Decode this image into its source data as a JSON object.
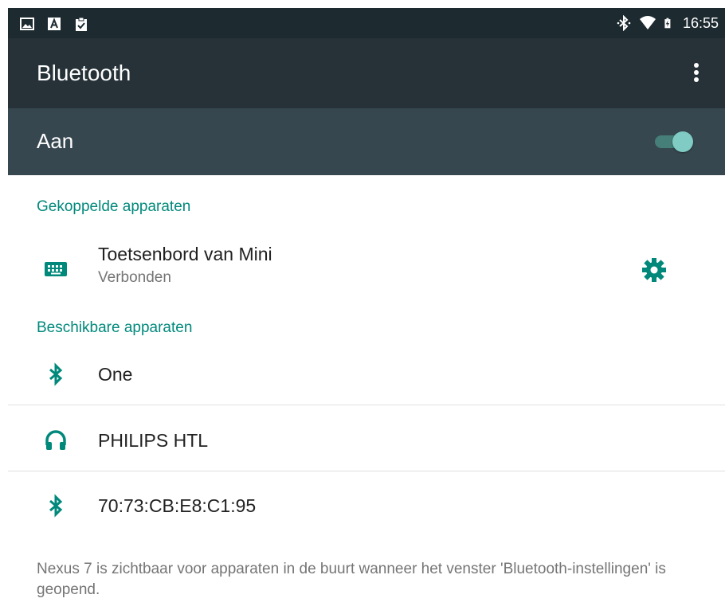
{
  "status_bar": {
    "time": "16:55",
    "left_icons": [
      "image-icon",
      "text-icon",
      "clipboard-check-icon"
    ],
    "right_icons": [
      "bluetooth-icon",
      "wifi-icon",
      "battery-charging-icon"
    ]
  },
  "app_bar": {
    "title": "Bluetooth",
    "menu_icon": "more-vert-icon"
  },
  "toggle": {
    "label": "Aan",
    "state": "on"
  },
  "paired_section": {
    "header": "Gekoppelde apparaten",
    "devices": [
      {
        "name": "Toetsenbord van Mini",
        "status": "Verbonden",
        "icon": "keyboard-icon",
        "action_icon": "gear-icon"
      }
    ]
  },
  "available_section": {
    "header": "Beschikbare apparaten",
    "devices": [
      {
        "name": "One",
        "icon": "bluetooth-icon"
      },
      {
        "name": "PHILIPS HTL",
        "icon": "headphones-icon"
      },
      {
        "name": "70:73:CB:E8:C1:95",
        "icon": "bluetooth-icon"
      }
    ]
  },
  "footer": {
    "text": "Nexus 7 is zichtbaar voor apparaten in de buurt wanneer het venster 'Bluetooth-instellingen' is geopend."
  },
  "colors": {
    "accent": "#00897b",
    "app_bar": "#263238",
    "toggle_row": "#37474f",
    "status_bar": "#1d2a30"
  }
}
